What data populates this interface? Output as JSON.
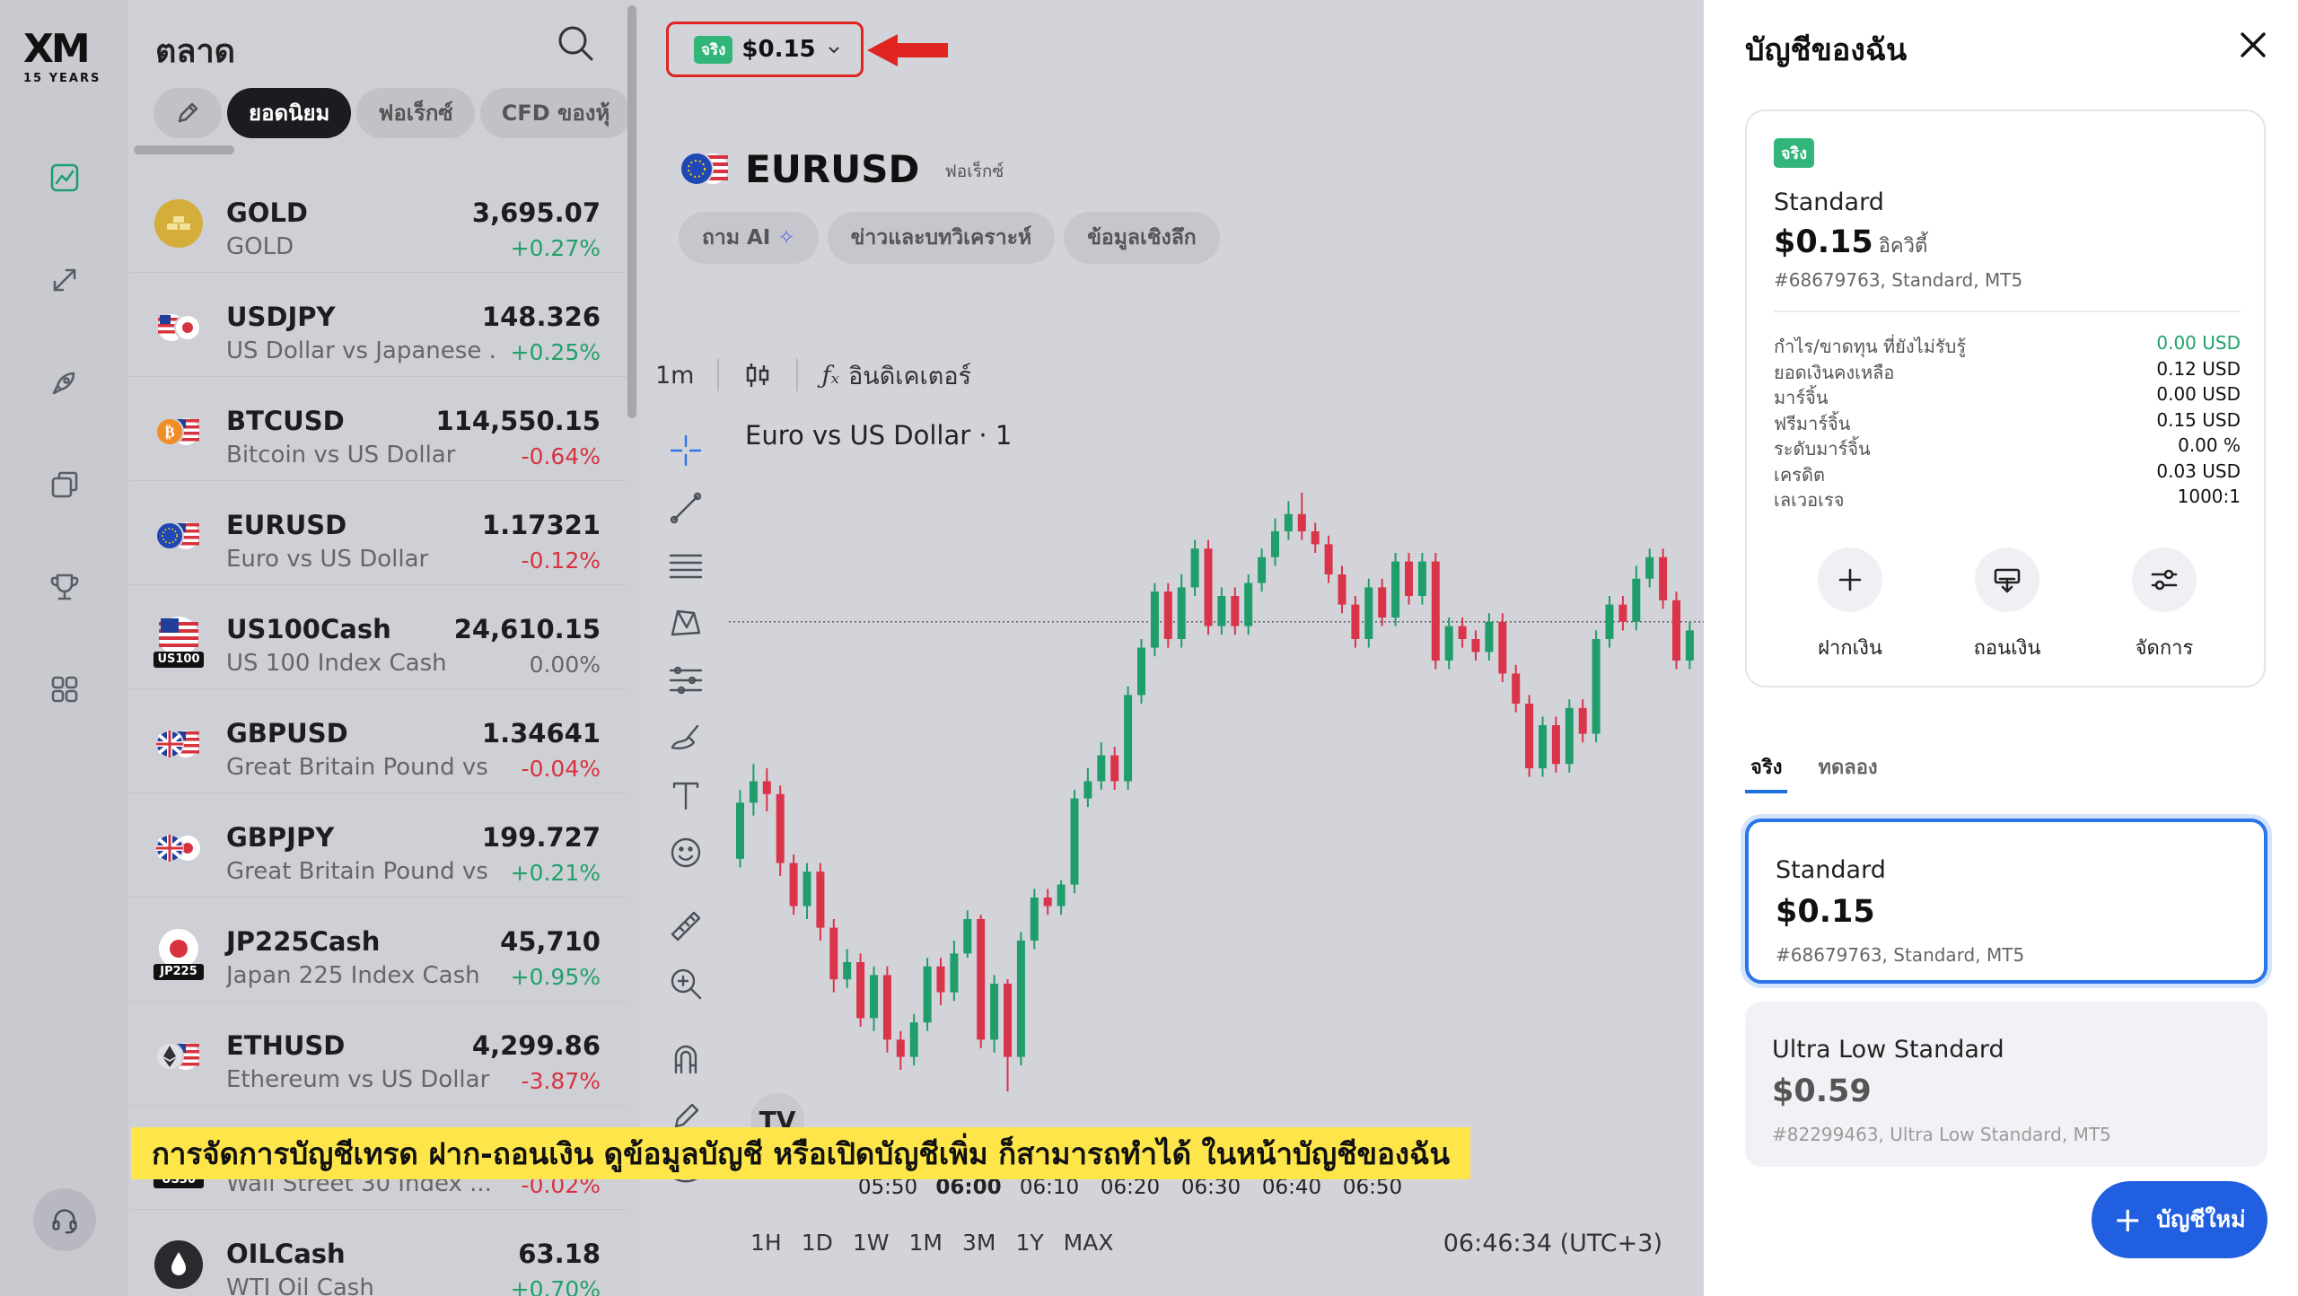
{
  "logo": {
    "text": "XM",
    "years": "15 YEARS"
  },
  "market": {
    "title": "ตลาด",
    "filters": [
      "ยอดนิยม",
      "ฟอเร็กซ์",
      "CFD ของหุ้"
    ],
    "rows": [
      {
        "symbol": "GOLD",
        "desc": "GOLD",
        "price": "3,695.07",
        "change": "+0.27%",
        "dir": "up",
        "flag": "gold"
      },
      {
        "symbol": "USDJPY",
        "desc": "US Dollar vs Japanese ...",
        "price": "148.326",
        "change": "+0.25%",
        "dir": "up",
        "flag": "usjp"
      },
      {
        "symbol": "BTCUSD",
        "desc": "Bitcoin vs US Dollar",
        "price": "114,550.15",
        "change": "-0.64%",
        "dir": "dn",
        "flag": "btc"
      },
      {
        "symbol": "EURUSD",
        "desc": "Euro vs US Dollar",
        "price": "1.17321",
        "change": "-0.12%",
        "dir": "dn",
        "flag": "euus"
      },
      {
        "symbol": "US100Cash",
        "desc": "US 100 Index Cash",
        "price": "24,610.15",
        "change": "0.00%",
        "dir": "neu",
        "flag": "us100",
        "tag": "US100"
      },
      {
        "symbol": "GBPUSD",
        "desc": "Great Britain Pound vs ...",
        "price": "1.34641",
        "change": "-0.04%",
        "dir": "dn",
        "flag": "gbus"
      },
      {
        "symbol": "GBPJPY",
        "desc": "Great Britain Pound vs ...",
        "price": "199.727",
        "change": "+0.21%",
        "dir": "up",
        "flag": "gbjp"
      },
      {
        "symbol": "JP225Cash",
        "desc": "Japan 225 Index Cash",
        "price": "45,710",
        "change": "+0.95%",
        "dir": "up",
        "flag": "jp225",
        "tag": "JP225"
      },
      {
        "symbol": "ETHUSD",
        "desc": "Ethereum vs US Dollar",
        "price": "4,299.86",
        "change": "-3.87%",
        "dir": "dn",
        "flag": "eth"
      },
      {
        "symbol": "",
        "desc": "Wall Street 30 Index ...",
        "price": "",
        "change": "-0.02%",
        "dir": "dn",
        "flag": "us30",
        "tag": "US30"
      },
      {
        "symbol": "OILCash",
        "desc": "WTI Oil Cash",
        "price": "63.18",
        "change": "+0.70%",
        "dir": "up",
        "flag": "oil"
      }
    ]
  },
  "account_button": {
    "badge": "จริง",
    "amount": "$0.15"
  },
  "instrument": {
    "symbol": "EURUSD",
    "category": "ฟอเร็กซ์",
    "tabs": [
      "ถาม AI",
      "ข่าวและบทวิเคราะห์",
      "ข้อมูลเชิงลึก"
    ]
  },
  "chart_toolbar": {
    "interval": "1m",
    "indicators": "อินดิเคเตอร์"
  },
  "chart_data": {
    "type": "candlestick",
    "title": "Euro vs US Dollar · 1",
    "x_ticks": [
      "05:50",
      "06:00",
      "06:10",
      "06:20",
      "06:30",
      "06:40",
      "06:50"
    ],
    "x_tick_bold": "06:00",
    "current_price_line": 0.64,
    "candles": [
      [
        0.09,
        0.22,
        0.07,
        0.25
      ],
      [
        0.22,
        0.27,
        0.19,
        0.31
      ],
      [
        0.27,
        0.24,
        0.2,
        0.3
      ],
      [
        0.24,
        0.08,
        0.05,
        0.26
      ],
      [
        0.08,
        -0.02,
        -0.04,
        0.1
      ],
      [
        -0.02,
        0.06,
        -0.05,
        0.08
      ],
      [
        0.06,
        -0.07,
        -0.1,
        0.08
      ],
      [
        -0.07,
        -0.19,
        -0.22,
        -0.05
      ],
      [
        -0.19,
        -0.15,
        -0.21,
        -0.12
      ],
      [
        -0.15,
        -0.28,
        -0.3,
        -0.13
      ],
      [
        -0.28,
        -0.18,
        -0.31,
        -0.16
      ],
      [
        -0.18,
        -0.33,
        -0.36,
        -0.16
      ],
      [
        -0.33,
        -0.37,
        -0.4,
        -0.31
      ],
      [
        -0.37,
        -0.29,
        -0.39,
        -0.27
      ],
      [
        -0.29,
        -0.16,
        -0.31,
        -0.14
      ],
      [
        -0.16,
        -0.22,
        -0.25,
        -0.14
      ],
      [
        -0.22,
        -0.13,
        -0.24,
        -0.1
      ],
      [
        -0.13,
        -0.05,
        -0.14,
        -0.03
      ],
      [
        -0.05,
        -0.33,
        -0.35,
        -0.04
      ],
      [
        -0.33,
        -0.2,
        -0.36,
        -0.18
      ],
      [
        -0.2,
        -0.37,
        -0.45,
        -0.19
      ],
      [
        -0.37,
        -0.1,
        -0.39,
        -0.08
      ],
      [
        -0.1,
        0.0,
        -0.12,
        0.02
      ],
      [
        0.0,
        -0.02,
        -0.04,
        0.02
      ],
      [
        -0.02,
        0.03,
        -0.04,
        0.04
      ],
      [
        0.03,
        0.23,
        0.01,
        0.25
      ],
      [
        0.23,
        0.27,
        0.21,
        0.3
      ],
      [
        0.27,
        0.33,
        0.25,
        0.36
      ],
      [
        0.33,
        0.27,
        0.25,
        0.35
      ],
      [
        0.27,
        0.47,
        0.25,
        0.49
      ],
      [
        0.47,
        0.58,
        0.45,
        0.6
      ],
      [
        0.58,
        0.71,
        0.56,
        0.73
      ],
      [
        0.71,
        0.6,
        0.58,
        0.73
      ],
      [
        0.6,
        0.72,
        0.58,
        0.75
      ],
      [
        0.72,
        0.81,
        0.7,
        0.83
      ],
      [
        0.81,
        0.63,
        0.61,
        0.83
      ],
      [
        0.63,
        0.7,
        0.61,
        0.72
      ],
      [
        0.7,
        0.63,
        0.61,
        0.72
      ],
      [
        0.63,
        0.73,
        0.61,
        0.75
      ],
      [
        0.73,
        0.79,
        0.71,
        0.81
      ],
      [
        0.79,
        0.85,
        0.77,
        0.88
      ],
      [
        0.85,
        0.89,
        0.83,
        0.92
      ],
      [
        0.89,
        0.85,
        0.83,
        0.94
      ],
      [
        0.85,
        0.82,
        0.8,
        0.87
      ],
      [
        0.82,
        0.75,
        0.73,
        0.84
      ],
      [
        0.75,
        0.68,
        0.66,
        0.77
      ],
      [
        0.68,
        0.6,
        0.58,
        0.7
      ],
      [
        0.6,
        0.72,
        0.58,
        0.74
      ],
      [
        0.72,
        0.65,
        0.63,
        0.74
      ],
      [
        0.65,
        0.78,
        0.63,
        0.8
      ],
      [
        0.78,
        0.7,
        0.68,
        0.8
      ],
      [
        0.7,
        0.78,
        0.68,
        0.8
      ],
      [
        0.78,
        0.55,
        0.53,
        0.8
      ],
      [
        0.55,
        0.63,
        0.53,
        0.65
      ],
      [
        0.63,
        0.6,
        0.58,
        0.65
      ],
      [
        0.6,
        0.57,
        0.55,
        0.62
      ],
      [
        0.57,
        0.64,
        0.55,
        0.66
      ],
      [
        0.64,
        0.52,
        0.5,
        0.66
      ],
      [
        0.52,
        0.45,
        0.43,
        0.54
      ],
      [
        0.45,
        0.3,
        0.28,
        0.47
      ],
      [
        0.3,
        0.4,
        0.28,
        0.42
      ],
      [
        0.4,
        0.31,
        0.29,
        0.42
      ],
      [
        0.31,
        0.44,
        0.29,
        0.46
      ],
      [
        0.44,
        0.38,
        0.36,
        0.46
      ],
      [
        0.38,
        0.6,
        0.36,
        0.62
      ],
      [
        0.6,
        0.68,
        0.58,
        0.7
      ],
      [
        0.68,
        0.64,
        0.62,
        0.7
      ],
      [
        0.64,
        0.74,
        0.62,
        0.77
      ],
      [
        0.74,
        0.79,
        0.72,
        0.81
      ],
      [
        0.79,
        0.69,
        0.67,
        0.81
      ],
      [
        0.69,
        0.55,
        0.53,
        0.71
      ],
      [
        0.55,
        0.62,
        0.53,
        0.64
      ]
    ]
  },
  "time_ranges": [
    "1H",
    "1D",
    "1W",
    "1M",
    "3M",
    "1Y",
    "MAX"
  ],
  "clock": "06:46:34 (UTC+3)",
  "caption": "การจัดการบัญชีเทรด ฝาก-ถอนเงิน ดูข้อมูลบัญชี หรือเปิดบัญชีเพิ่ม ก็สามารถทำได้ ในหน้าบัญชีของฉัน",
  "panel": {
    "title": "บัญชีของฉัน",
    "card": {
      "badge": "จริง",
      "name": "Standard",
      "balance": "$0.15",
      "balance_unit": "อิควิตี้",
      "meta": "#68679763, Standard, MT5",
      "stats": [
        {
          "k": "กำไร/ขาดทุน ที่ยังไม่รับรู้",
          "v": "0.00 USD",
          "green": true
        },
        {
          "k": "ยอดเงินคงเหลือ",
          "v": "0.12 USD"
        },
        {
          "k": "มาร์จิ้น",
          "v": "0.00 USD"
        },
        {
          "k": "ฟรีมาร์จิ้น",
          "v": "0.15 USD"
        },
        {
          "k": "ระดับมาร์จิ้น",
          "v": "0.00 %"
        },
        {
          "k": "เครดิต",
          "v": "0.03 USD"
        },
        {
          "k": "เลเวอเรจ",
          "v": "1000:1"
        }
      ],
      "actions": [
        "ฝากเงิน",
        "ถอนเงิน",
        "จัดการ"
      ]
    },
    "tabs": [
      "จริง",
      "ทดลอง"
    ],
    "accounts": [
      {
        "name": "Standard",
        "balance": "$0.15",
        "meta": "#68679763, Standard, MT5"
      },
      {
        "name": "Ultra Low Standard",
        "balance": "$0.59",
        "meta": "#82299463, Ultra Low Standard, MT5"
      }
    ],
    "new_account": "บัญชีใหม่"
  }
}
